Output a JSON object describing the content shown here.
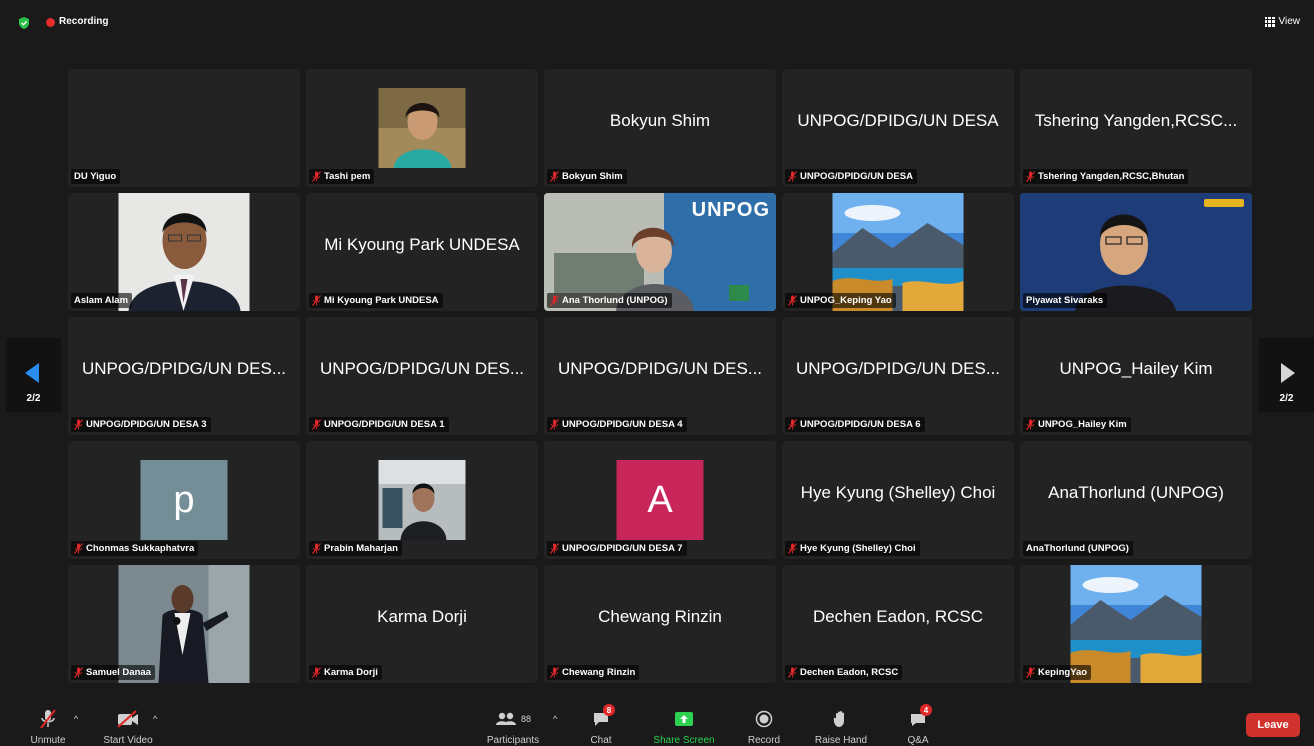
{
  "topbar": {
    "recording_label": "Recording",
    "view_label": "View"
  },
  "pagination": {
    "left_label": "2/2",
    "right_label": "2/2"
  },
  "tiles": [
    {
      "display_name": "",
      "label": "DU Yiguo",
      "muted": false,
      "kind": "empty"
    },
    {
      "display_name": "",
      "label": "Tashi pem",
      "muted": true,
      "kind": "photo-woman"
    },
    {
      "display_name": "Bokyun Shim",
      "label": "Bokyun Shim",
      "muted": true,
      "kind": "name"
    },
    {
      "display_name": "UNPOG/DPIDG/UN DESA",
      "label": "UNPOG/DPIDG/UN DESA",
      "muted": true,
      "kind": "name"
    },
    {
      "display_name": "Tshering Yangden,RCSC...",
      "label": "Tshering Yangden,RCSC,Bhutan",
      "muted": true,
      "kind": "name"
    },
    {
      "display_name": "",
      "label": "Aslam Alam",
      "muted": false,
      "kind": "photo-man"
    },
    {
      "display_name": "Mi Kyoung Park UNDESA",
      "label": "Mi Kyoung Park UNDESA",
      "muted": true,
      "kind": "name"
    },
    {
      "display_name": "",
      "label": "Ana Thorlund (UNPOG)",
      "muted": true,
      "kind": "video-office"
    },
    {
      "display_name": "",
      "label": "UNPOG_Keping Yao",
      "muted": true,
      "kind": "photo-landscape"
    },
    {
      "display_name": "",
      "label": "Piyawat Sivaraks",
      "muted": false,
      "kind": "video-man",
      "active": true
    },
    {
      "display_name": "UNPOG/DPIDG/UN DES...",
      "label": "UNPOG/DPIDG/UN DESA 3",
      "muted": true,
      "kind": "name"
    },
    {
      "display_name": "UNPOG/DPIDG/UN DES...",
      "label": "UNPOG/DPIDG/UN DESA 1",
      "muted": true,
      "kind": "name"
    },
    {
      "display_name": "UNPOG/DPIDG/UN DES...",
      "label": "UNPOG/DPIDG/UN DESA 4",
      "muted": true,
      "kind": "name"
    },
    {
      "display_name": "UNPOG/DPIDG/UN DES...",
      "label": "UNPOG/DPIDG/UN DESA 6",
      "muted": true,
      "kind": "name"
    },
    {
      "display_name": "UNPOG_Hailey Kim",
      "label": "UNPOG_Hailey Kim",
      "muted": true,
      "kind": "name"
    },
    {
      "display_name": "",
      "label": "Chonmas Sukkaphatvra",
      "muted": true,
      "kind": "avatar",
      "letter": "p",
      "color": "#748e98"
    },
    {
      "display_name": "",
      "label": "Prabin Maharjan",
      "muted": true,
      "kind": "photo-office"
    },
    {
      "display_name": "",
      "label": "UNPOG/DPIDG/UN DESA 7",
      "muted": true,
      "kind": "avatar",
      "letter": "A",
      "color": "#c8265a"
    },
    {
      "display_name": "Hye Kyung (Shelley) Choi",
      "label": "Hye Kyung (Shelley) Choi",
      "muted": true,
      "kind": "name"
    },
    {
      "display_name": "AnaThorlund (UNPOG)",
      "label": "AnaThorlund (UNPOG)",
      "muted": false,
      "kind": "name"
    },
    {
      "display_name": "",
      "label": "Samuel Danaa",
      "muted": true,
      "kind": "photo-speaker"
    },
    {
      "display_name": "Karma Dorji",
      "label": "Karma Dorji",
      "muted": true,
      "kind": "name"
    },
    {
      "display_name": "Chewang Rinzin",
      "label": "Chewang Rinzin",
      "muted": true,
      "kind": "name"
    },
    {
      "display_name": "Dechen Eadon, RCSC",
      "label": "Dechen Eadon, RCSC",
      "muted": true,
      "kind": "name"
    },
    {
      "display_name": "",
      "label": "KepingYao",
      "muted": true,
      "kind": "photo-landscape"
    }
  ],
  "video_text": {
    "unpog": "UNPOG"
  },
  "toolbar": {
    "unmute_label": "Unmute",
    "start_video_label": "Start Video",
    "participants_label": "Participants",
    "participants_count": "88",
    "chat_label": "Chat",
    "chat_badge": "8",
    "share_label": "Share Screen",
    "record_label": "Record",
    "raise_hand_label": "Raise Hand",
    "qa_label": "Q&A",
    "qa_badge": "4",
    "leave_label": "Leave"
  },
  "colors": {
    "share_green": "#2bd14f",
    "leave_red": "#d2322d",
    "recording_red": "#e52b2b",
    "active_border": "#30c030"
  }
}
